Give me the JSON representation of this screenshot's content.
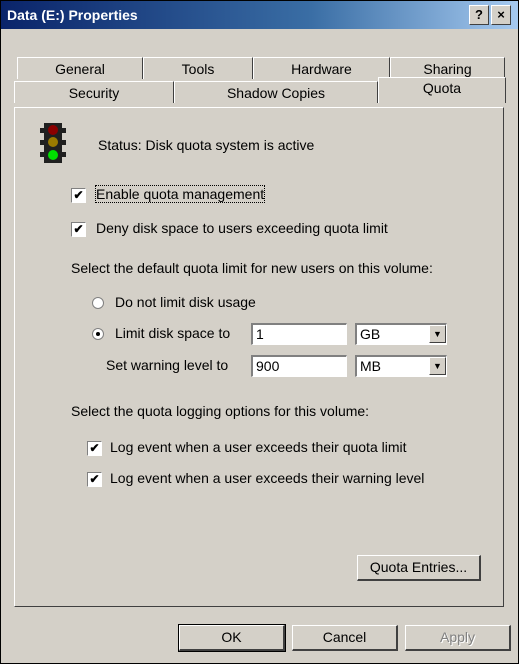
{
  "window": {
    "title": "Data (E:) Properties",
    "help_label": "?",
    "close_label": "×"
  },
  "tabs": {
    "row1": [
      "General",
      "Tools",
      "Hardware",
      "Sharing"
    ],
    "row2": [
      "Security",
      "Shadow Copies",
      "Quota"
    ],
    "active": "Quota"
  },
  "quota": {
    "status": "Status:  Disk quota system is active",
    "enable_label": "Enable quota management",
    "enable_checked": true,
    "deny_label": "Deny disk space to users exceeding quota limit",
    "deny_checked": true,
    "default_limit_heading": "Select the default quota limit for new users on this volume:",
    "no_limit_label": "Do not limit disk usage",
    "limit_label": "Limit disk space to",
    "limit_value": "1",
    "limit_unit": "GB",
    "warning_label": "Set warning level to",
    "warning_value": "900",
    "warning_unit": "MB",
    "logging_heading": "Select the quota logging options for this volume:",
    "log_quota_label": "Log event when a user exceeds their quota limit",
    "log_quota_checked": true,
    "log_warning_label": "Log event when a user exceeds their warning level",
    "log_warning_checked": true,
    "entries_button": "Quota Entries..."
  },
  "buttons": {
    "ok": "OK",
    "cancel": "Cancel",
    "apply": "Apply"
  },
  "check_glyph": "✔",
  "icons": [
    "traffic-light-icon",
    "help-icon",
    "close-icon",
    "dropdown-arrow-icon"
  ]
}
